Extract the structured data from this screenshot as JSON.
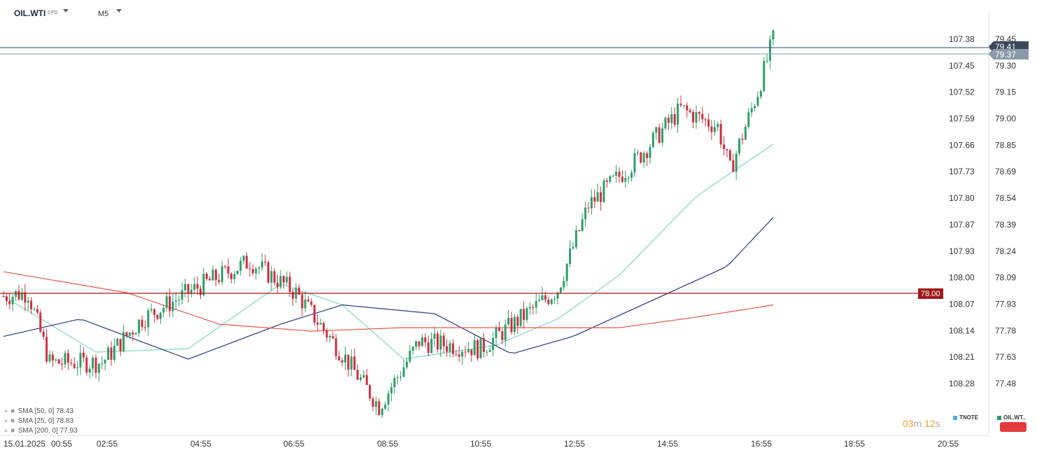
{
  "toolbar": {
    "symbol": "OIL.WTI",
    "symbol_tag": "CFD",
    "timeframe": "M5"
  },
  "mid_axis": {
    "labels": [
      "107.38",
      "107.45",
      "107.52",
      "107.59",
      "107.66",
      "107.73",
      "107.80",
      "107.87",
      "107.93",
      "108.00",
      "108.07",
      "108.14",
      "108.21",
      "108.28"
    ]
  },
  "price_axis": {
    "labels": [
      "79.45",
      "79.30",
      "79.15",
      "79.00",
      "78.85",
      "78.69",
      "78.54",
      "78.39",
      "78.24",
      "78.09",
      "77.93",
      "77.78",
      "77.63",
      "77.48"
    ],
    "marker_top": "79.41",
    "marker_bottom": "79.37",
    "level_label": "78.00"
  },
  "time_axis": {
    "labels": [
      "15.01.2025",
      "00:55",
      "02:55",
      "04:55",
      "06:55",
      "08:55",
      "10:55",
      "12:55",
      "14:55",
      "16:55",
      "18:55",
      "20:55"
    ]
  },
  "indicators": [
    {
      "label": "SMA  [50, 0]  78.43",
      "color": "#2a3580"
    },
    {
      "label": "SMA  [25, 0]  78.83",
      "color": "#7fd8c0"
    },
    {
      "label": "SMA  [200, 0]  77.93",
      "color": "#e05a4e"
    }
  ],
  "countdown": {
    "min": "03",
    "min_unit": "m",
    "sec": "12",
    "sec_unit": "s"
  },
  "tags": [
    {
      "label": "TNOTE",
      "color": "#4ab0e8"
    },
    {
      "label": "OIL.WT..",
      "color": "#2e9e6a"
    }
  ],
  "colors": {
    "up": "#2e9e6a",
    "down": "#d0303f",
    "level": "#a01a1a",
    "hline_top": "#3a4a5a",
    "hline_bottom": "#8a9aaa"
  },
  "chart_data": {
    "type": "candlestick",
    "x_axis_labels": [
      "00:55",
      "02:55",
      "04:55",
      "06:55",
      "08:55",
      "10:55",
      "12:55",
      "14:55",
      "16:55",
      "18:55",
      "20:55"
    ],
    "ylim": [
      77.4,
      79.6
    ],
    "horizontal_levels": [
      79.41,
      79.37,
      78.0
    ],
    "waypoints_close": [
      [
        0,
        77.98
      ],
      [
        8,
        78.0
      ],
      [
        15,
        77.6
      ],
      [
        32,
        77.6
      ],
      [
        45,
        77.85
      ],
      [
        65,
        78.05
      ],
      [
        80,
        78.18
      ],
      [
        95,
        78.0
      ],
      [
        110,
        77.65
      ],
      [
        122,
        77.35
      ],
      [
        135,
        77.72
      ],
      [
        155,
        77.68
      ],
      [
        170,
        77.88
      ],
      [
        180,
        78.02
      ],
      [
        190,
        78.5
      ],
      [
        205,
        78.75
      ],
      [
        220,
        79.05
      ],
      [
        232,
        78.95
      ],
      [
        236,
        78.7
      ],
      [
        245,
        79.15
      ],
      [
        250,
        79.45
      ]
    ],
    "sma": [
      {
        "name": "SMA [25, 0]",
        "value": 78.83,
        "points": [
          [
            0,
            77.98
          ],
          [
            30,
            77.66
          ],
          [
            60,
            77.68
          ],
          [
            90,
            78.05
          ],
          [
            110,
            77.93
          ],
          [
            130,
            77.62
          ],
          [
            160,
            77.7
          ],
          [
            180,
            77.85
          ],
          [
            200,
            78.1
          ],
          [
            225,
            78.55
          ],
          [
            250,
            78.85
          ]
        ]
      },
      {
        "name": "SMA [50, 0]",
        "value": 78.43,
        "points": [
          [
            0,
            77.75
          ],
          [
            25,
            77.85
          ],
          [
            60,
            77.62
          ],
          [
            90,
            77.82
          ],
          [
            110,
            77.93
          ],
          [
            140,
            77.88
          ],
          [
            165,
            77.65
          ],
          [
            185,
            77.75
          ],
          [
            210,
            77.95
          ],
          [
            235,
            78.15
          ],
          [
            250,
            78.43
          ]
        ]
      },
      {
        "name": "SMA [200, 0]",
        "value": 77.93,
        "points": [
          [
            0,
            78.12
          ],
          [
            40,
            78.0
          ],
          [
            70,
            77.82
          ],
          [
            100,
            77.78
          ],
          [
            130,
            77.8
          ],
          [
            160,
            77.8
          ],
          [
            200,
            77.8
          ],
          [
            225,
            77.86
          ],
          [
            250,
            77.93
          ]
        ]
      }
    ]
  }
}
